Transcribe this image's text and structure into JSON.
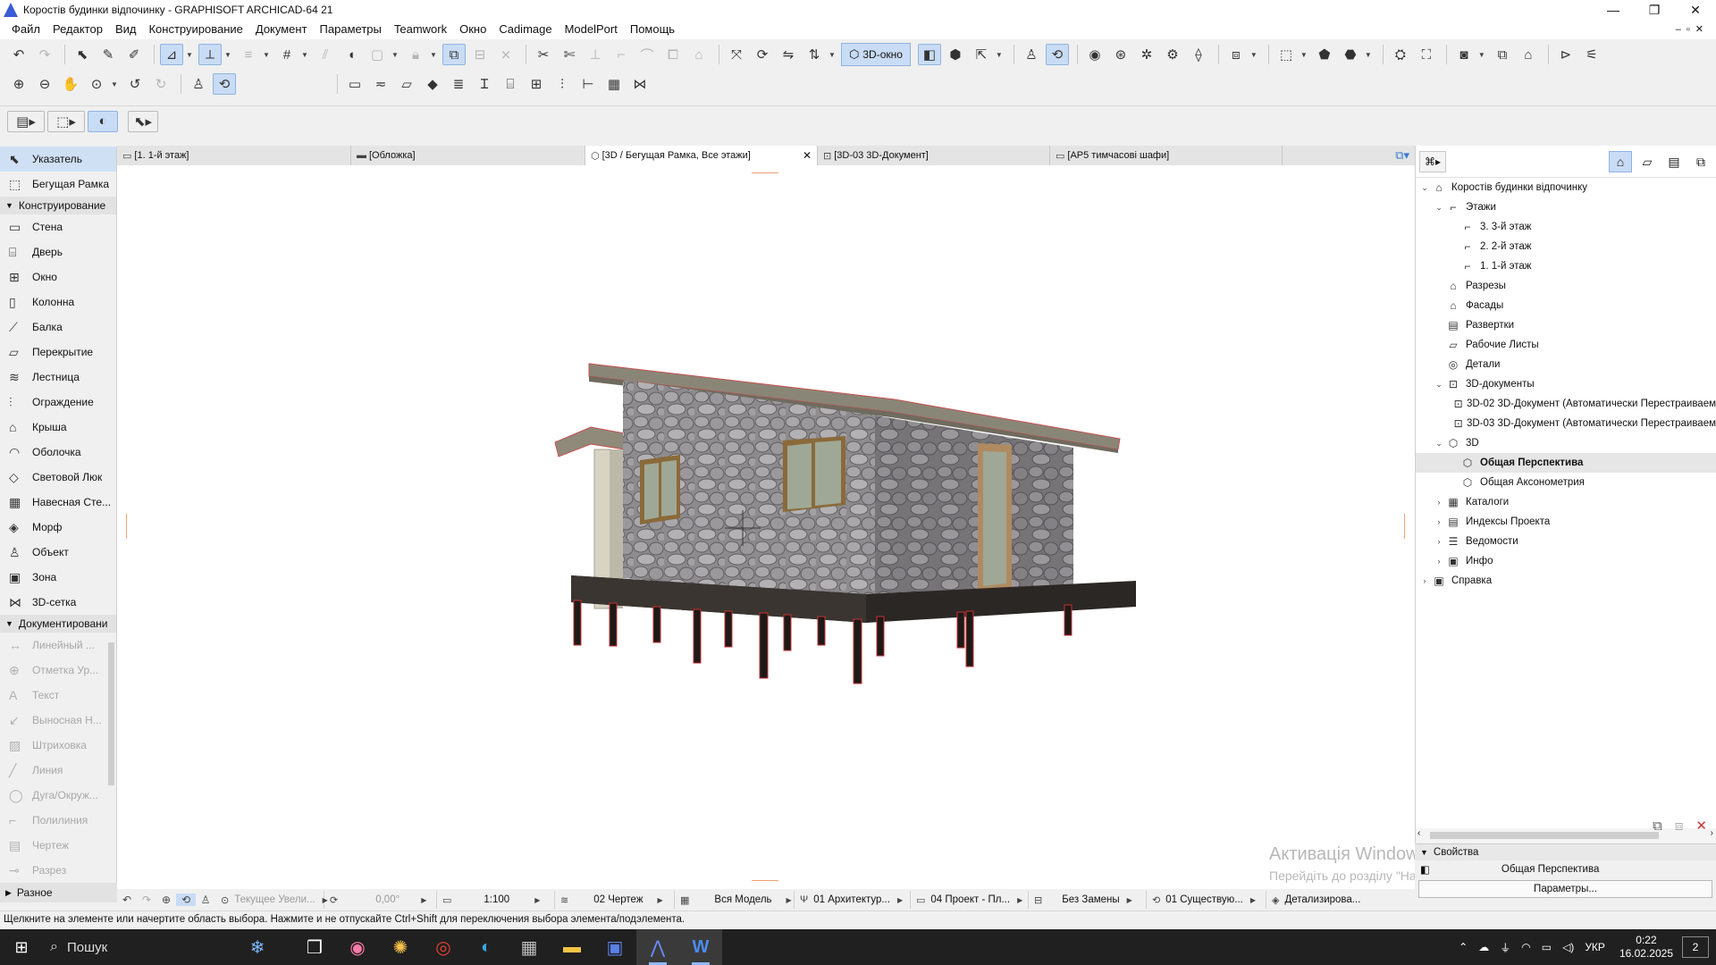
{
  "window": {
    "title": "Коростів будинки відпочинку - GRAPHISOFT ARCHICAD-64 21",
    "controls": [
      "—",
      "❐",
      "✕"
    ]
  },
  "menu": [
    "Файл",
    "Редактор",
    "Вид",
    "Конструирование",
    "Документ",
    "Параметры",
    "Teamwork",
    "Окно",
    "Cadimage",
    "ModelPort",
    "Помощь"
  ],
  "toolbar": {
    "view3d_label": "3D-окно"
  },
  "toolbox": {
    "top_items": [
      {
        "label": "Указатель",
        "icon": "arrow-pointer-icon",
        "glyph": "⬉"
      },
      {
        "label": "Бегущая Рамка",
        "icon": "marquee-icon",
        "glyph": "⬚"
      }
    ],
    "group_design": "Конструирование",
    "design_items": [
      {
        "label": "Стена",
        "icon": "wall-icon",
        "glyph": "▭"
      },
      {
        "label": "Дверь",
        "icon": "door-icon",
        "glyph": "⌸"
      },
      {
        "label": "Окно",
        "icon": "window-icon",
        "glyph": "⊞"
      },
      {
        "label": "Колонна",
        "icon": "column-icon",
        "glyph": "▯"
      },
      {
        "label": "Балка",
        "icon": "beam-icon",
        "glyph": "⟋"
      },
      {
        "label": "Перекрытие",
        "icon": "slab-icon",
        "glyph": "▱"
      },
      {
        "label": "Лестница",
        "icon": "stair-icon",
        "glyph": "≋"
      },
      {
        "label": "Ограждение",
        "icon": "railing-icon",
        "glyph": "⫶"
      },
      {
        "label": "Крыша",
        "icon": "roof-icon",
        "glyph": "⌂"
      },
      {
        "label": "Оболочка",
        "icon": "shell-icon",
        "glyph": "◠"
      },
      {
        "label": "Световой Люк",
        "icon": "skylight-icon",
        "glyph": "◇"
      },
      {
        "label": "Навесная Сте...",
        "icon": "curtain-wall-icon",
        "glyph": "▦"
      },
      {
        "label": "Морф",
        "icon": "morph-icon",
        "glyph": "◈"
      },
      {
        "label": "Объект",
        "icon": "object-icon",
        "glyph": "♙"
      },
      {
        "label": "Зона",
        "icon": "zone-icon",
        "glyph": "▣"
      },
      {
        "label": "3D-сетка",
        "icon": "mesh-icon",
        "glyph": "⋈"
      }
    ],
    "group_docs": "Документировани",
    "doc_items": [
      {
        "label": "Линейный ...",
        "icon": "dimension-icon",
        "glyph": "↔"
      },
      {
        "label": "Отметка Ур...",
        "icon": "level-dimension-icon",
        "glyph": "⊕"
      },
      {
        "label": "Текст",
        "icon": "text-icon",
        "glyph": "A"
      },
      {
        "label": "Выносная Н...",
        "icon": "label-icon",
        "glyph": "↙"
      },
      {
        "label": "Штриховка",
        "icon": "fill-icon",
        "glyph": "▨"
      },
      {
        "label": "Линия",
        "icon": "line-icon",
        "glyph": "╱"
      },
      {
        "label": "Дуга/Окруж...",
        "icon": "arc-icon",
        "glyph": "◯"
      },
      {
        "label": "Полилиния",
        "icon": "polyline-icon",
        "glyph": "⌐"
      },
      {
        "label": "Чертеж",
        "icon": "drawing-icon",
        "glyph": "▤"
      },
      {
        "label": "Разрез",
        "icon": "section-icon",
        "glyph": "⊸"
      }
    ],
    "footer": "Разное"
  },
  "tabs": [
    {
      "label": "[1. 1-й этаж]",
      "icon": "floorplan-tab-icon",
      "glyph": "▭",
      "active": false
    },
    {
      "label": "[Обложка]",
      "icon": "layout-tab-icon",
      "glyph": "▬",
      "active": false
    },
    {
      "label": "[3D / Бегущая Рамка, Все этажи]",
      "icon": "3d-tab-icon",
      "glyph": "⬡",
      "active": true
    },
    {
      "label": "[3D-03 3D-Документ]",
      "icon": "3d-document-tab-icon",
      "glyph": "⊡",
      "active": false
    },
    {
      "label": "[АР5 тимчасові шафи]",
      "icon": "layout-tab-icon",
      "glyph": "▭",
      "active": false
    }
  ],
  "navigator": {
    "tree": [
      {
        "label": "Коростів будинки відпочинку",
        "level": 0,
        "exp": "v",
        "icon": "project-icon",
        "glyph": "⌂"
      },
      {
        "label": "Этажи",
        "level": 1,
        "exp": "v",
        "icon": "stories-icon",
        "glyph": "⌐"
      },
      {
        "label": "3. 3-й этаж",
        "level": 2,
        "exp": "",
        "icon": "story-icon",
        "glyph": "⌐"
      },
      {
        "label": "2. 2-й этаж",
        "level": 2,
        "exp": "",
        "icon": "story-icon",
        "glyph": "⌐"
      },
      {
        "label": "1. 1-й этаж",
        "level": 2,
        "exp": "",
        "icon": "story-icon",
        "glyph": "⌐"
      },
      {
        "label": "Разрезы",
        "level": 1,
        "exp": "",
        "icon": "sections-icon",
        "glyph": "⌂"
      },
      {
        "label": "Фасады",
        "level": 1,
        "exp": "",
        "icon": "elevations-icon",
        "glyph": "⌂"
      },
      {
        "label": "Развертки",
        "level": 1,
        "exp": "",
        "icon": "interior-elevations-icon",
        "glyph": "▤"
      },
      {
        "label": "Рабочие Листы",
        "level": 1,
        "exp": "",
        "icon": "worksheets-icon",
        "glyph": "▱"
      },
      {
        "label": "Детали",
        "level": 1,
        "exp": "",
        "icon": "details-icon",
        "glyph": "◎"
      },
      {
        "label": "3D-документы",
        "level": 1,
        "exp": "v",
        "icon": "3d-documents-icon",
        "glyph": "⊡"
      },
      {
        "label": "3D-02 3D-Документ (Автоматически Перестраиваем",
        "level": 2,
        "exp": "",
        "icon": "3d-document-icon",
        "glyph": "⊡"
      },
      {
        "label": "3D-03 3D-Документ (Автоматически Перестраиваем",
        "level": 2,
        "exp": "",
        "icon": "3d-document-icon",
        "glyph": "⊡"
      },
      {
        "label": "3D",
        "level": 1,
        "exp": "v",
        "icon": "3d-folder-icon",
        "glyph": "⬡"
      },
      {
        "label": "Общая Перспектива",
        "level": 2,
        "exp": "",
        "icon": "perspective-icon",
        "glyph": "⬡",
        "selected": true
      },
      {
        "label": "Общая Аксонометрия",
        "level": 2,
        "exp": "",
        "icon": "axonometry-icon",
        "glyph": "⬡"
      },
      {
        "label": "Каталоги",
        "level": 1,
        "exp": ">",
        "icon": "schedules-icon",
        "glyph": "▦"
      },
      {
        "label": "Индексы Проекта",
        "level": 1,
        "exp": ">",
        "icon": "project-indexes-icon",
        "glyph": "▤"
      },
      {
        "label": "Ведомости",
        "level": 1,
        "exp": ">",
        "icon": "lists-icon",
        "glyph": "☰"
      },
      {
        "label": "Инфо",
        "level": 1,
        "exp": ">",
        "icon": "info-icon",
        "glyph": "▣"
      },
      {
        "label": "Справка",
        "level": 0,
        "exp": ">",
        "icon": "help-icon",
        "glyph": "▣"
      }
    ]
  },
  "properties": {
    "header": "Свойства",
    "value": "Общая Перспектива",
    "button": "Параметры..."
  },
  "watermark": {
    "line1": "Активація Windows",
    "line2": "Перейдіть до розділу \"Настройки\", щоб активувати Windows."
  },
  "quick_options": {
    "zoom": "Текущее Увели...",
    "angle": "0,00°",
    "scale": "1:100",
    "layer_combo": "02 Чертеж",
    "model_view": "Вся Модель",
    "pen_set": "01 Архитектур...",
    "mvo": "04 Проект - Пл...",
    "override": "Без Замены",
    "renovation": "01 Существую...",
    "detail": "Детализирова..."
  },
  "status": "Щелкните на элементе или начертите область выбора. Нажмите и не отпускайте Ctrl+Shift для переключения выбора элемента/подэлемента.",
  "taskbar": {
    "search": "Пошук",
    "lang": "УКР",
    "time": "0:22",
    "date": "16.02.2025",
    "notifications": "2"
  }
}
